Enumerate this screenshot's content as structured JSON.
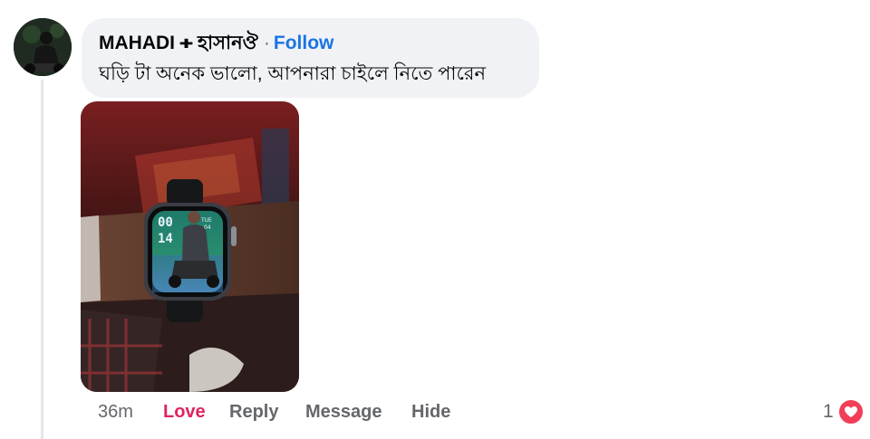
{
  "comment": {
    "author": "MAHADI ᚐ হাসানঔ",
    "separator": "·",
    "follow_label": "Follow",
    "text": "ঘড়ি টা অনেক ভালো, আপনারা চাইলে নিতে পারেন"
  },
  "actions": {
    "time": "36m",
    "love_label": "Love",
    "reply_label": "Reply",
    "message_label": "Message",
    "hide_label": "Hide"
  },
  "reactions": {
    "count": "1",
    "type": "heart-icon"
  },
  "watch_face": {
    "hours": "00",
    "minutes": "14",
    "day": "TUE",
    "date": "04"
  },
  "colors": {
    "bubble": "#f0f2f5",
    "follow": "#1b74e4",
    "love": "#e0245e",
    "heart_badge": "#f33e58",
    "muted": "#65676b"
  }
}
